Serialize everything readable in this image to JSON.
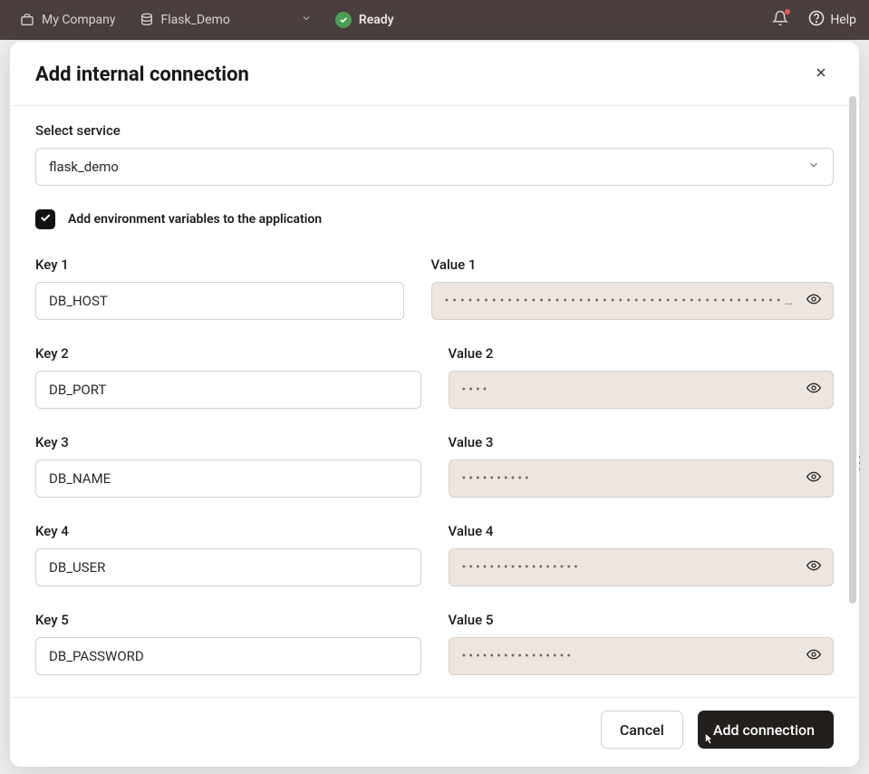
{
  "topbar": {
    "company": "My Company",
    "project": "Flask_Demo",
    "status": "Ready",
    "help": "Help"
  },
  "modal": {
    "title": "Add internal connection",
    "select_label": "Select service",
    "select_value": "flask_demo",
    "checkbox_label": "Add environment variables to the application",
    "pairs": [
      {
        "key_label": "Key 1",
        "key_value": "DB_HOST",
        "value_label": "Value 1",
        "mask": "•••••••••••••••••••••••••••••••••••••••••••…",
        "long": true
      },
      {
        "key_label": "Key 2",
        "key_value": "DB_PORT",
        "value_label": "Value 2",
        "mask": "••••",
        "long": false
      },
      {
        "key_label": "Key 3",
        "key_value": "DB_NAME",
        "value_label": "Value 3",
        "mask": "••••••••••",
        "long": false
      },
      {
        "key_label": "Key 4",
        "key_value": "DB_USER",
        "value_label": "Value 4",
        "mask": "•••••••••••••••••",
        "long": false
      },
      {
        "key_label": "Key 5",
        "key_value": "DB_PASSWORD",
        "value_label": "Value 5",
        "mask": "••••••••••••••••",
        "long": false
      }
    ],
    "cancel": "Cancel",
    "submit": "Add connection"
  }
}
